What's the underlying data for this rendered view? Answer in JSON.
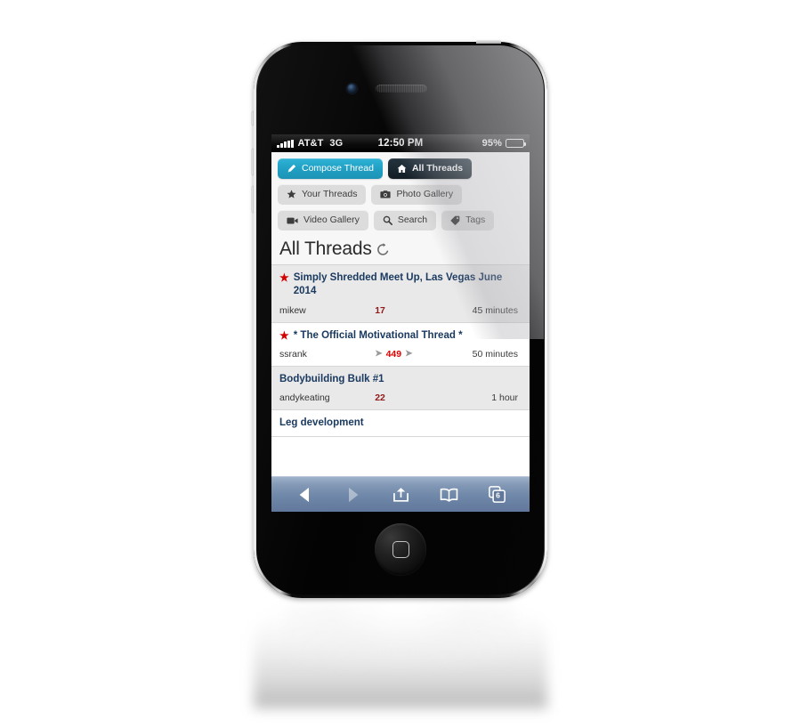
{
  "status_bar": {
    "carrier": "AT&T",
    "network": "3G",
    "time": "12:50 PM",
    "battery_percent": "95%",
    "signal_bars": 5
  },
  "nav": {
    "primary_buttons": [
      {
        "label": "Compose Thread",
        "icon": "pencil-icon",
        "style": "primary"
      },
      {
        "label": "All Threads",
        "icon": "home-icon",
        "style": "dark"
      }
    ],
    "secondary_buttons": [
      {
        "label": "Your Threads",
        "icon": "star-icon"
      },
      {
        "label": "Photo Gallery",
        "icon": "camera-icon"
      },
      {
        "label": "Video Gallery",
        "icon": "video-camera-icon"
      },
      {
        "label": "Search",
        "icon": "search-icon"
      },
      {
        "label": "Tags",
        "icon": "tag-icon"
      }
    ]
  },
  "heading": {
    "title": "All Threads",
    "refresh_icon": "refresh-icon"
  },
  "threads": [
    {
      "title": "Simply Shredded Meet Up, Las Vegas June 2014",
      "starred": true,
      "author": "mikew",
      "replies": "17",
      "paged": false,
      "time": "45 minutes",
      "shaded": true
    },
    {
      "title": "* The Official Motivational Thread *",
      "starred": true,
      "author": "ssrank",
      "replies": "449",
      "paged": true,
      "time": "50 minutes",
      "shaded": false
    },
    {
      "title": "Bodybuilding Bulk #1",
      "starred": false,
      "author": "andykeating",
      "replies": "22",
      "paged": false,
      "time": "1 hour",
      "shaded": true
    },
    {
      "title": "Leg development",
      "starred": false,
      "author": "",
      "replies": "",
      "paged": false,
      "time": "",
      "shaded": false
    }
  ],
  "toolbar": {
    "items": [
      {
        "name": "back-icon",
        "enabled": true
      },
      {
        "name": "forward-icon",
        "enabled": false
      },
      {
        "name": "share-icon",
        "enabled": true
      },
      {
        "name": "bookmarks-icon",
        "enabled": true
      },
      {
        "name": "tabs-icon",
        "enabled": true
      }
    ],
    "tab_count": "6"
  },
  "colors": {
    "accent_teal": "#20a0c4",
    "dark_button": "#192730",
    "star_red": "#d00000",
    "title_blue": "#1b3a60",
    "count_dark_red": "#8f1a1a",
    "count_bright_red": "#e00000"
  }
}
